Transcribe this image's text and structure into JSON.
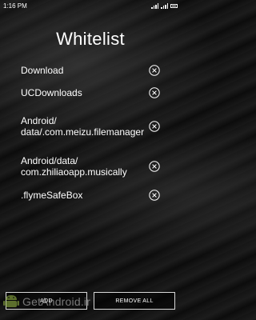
{
  "status": {
    "time": "1:16 PM"
  },
  "title": "Whitelist",
  "items": [
    {
      "label": "Download"
    },
    {
      "label": "UCDownloads"
    },
    {
      "label": "Android/\ndata/.com.meizu.filemanager"
    },
    {
      "label": "Android/data/\ncom.zhiliaoapp.musically"
    },
    {
      "label": ".flymeSafeBox"
    }
  ],
  "buttons": {
    "add": "ADD",
    "remove_all": "REMOVE ALL"
  },
  "watermark": {
    "text": "GetAndroid.ir"
  },
  "icons": {
    "remove": "remove-circle-x-icon",
    "signal": "signal-icon",
    "battery": "battery-icon",
    "watermark": "android-logo-icon"
  }
}
